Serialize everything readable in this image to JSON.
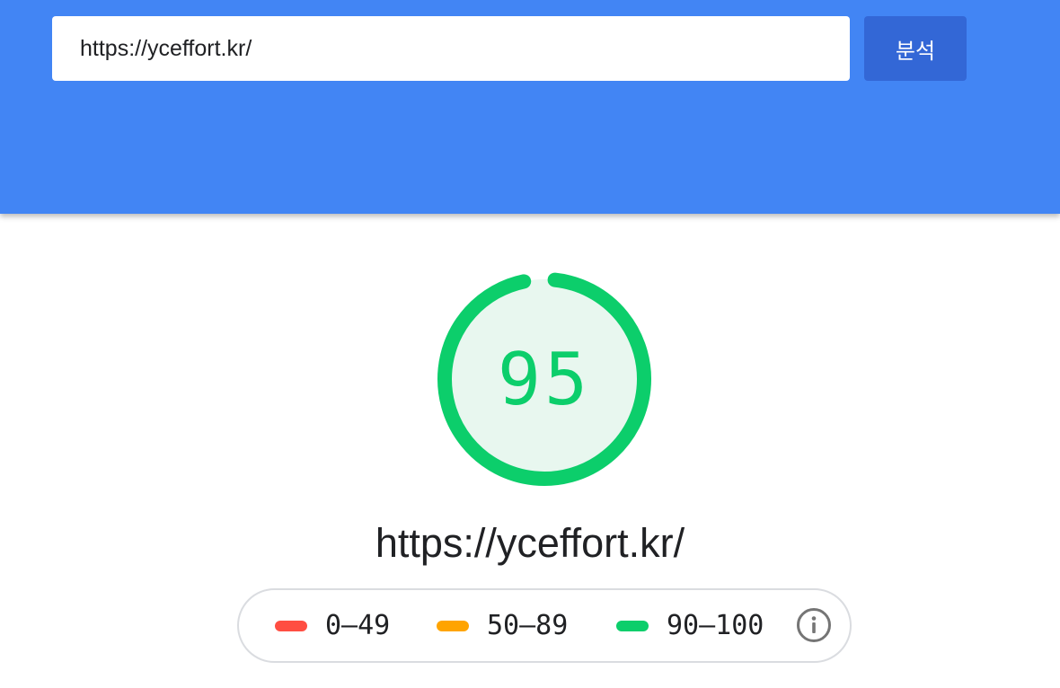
{
  "header": {
    "url_input_value": "https://yceffort.kr/",
    "analyze_button_label": "분석"
  },
  "score": {
    "value": 95,
    "display": "95",
    "color": "#0cce6b",
    "background_color": "#e8f7ef"
  },
  "tested_url": "https://yceffort.kr/",
  "legend": {
    "items": [
      {
        "label": "0–49",
        "color": "#ff4e42"
      },
      {
        "label": "50–89",
        "color": "#ffa400"
      },
      {
        "label": "90–100",
        "color": "#0cce6b"
      }
    ],
    "info_icon": "info-icon"
  },
  "colors": {
    "header_background": "#4285f4",
    "button_background": "#3367d6"
  }
}
